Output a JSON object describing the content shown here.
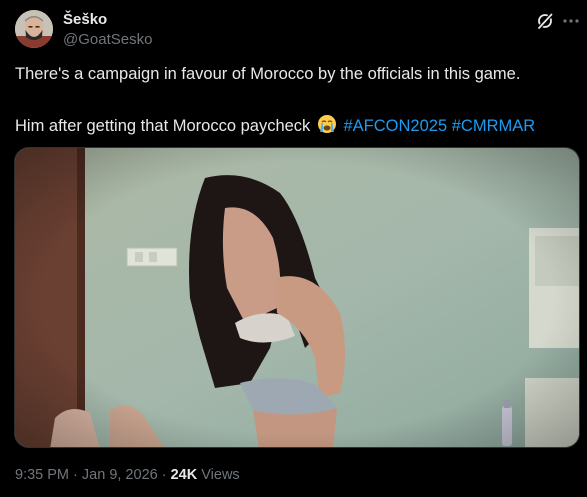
{
  "author": {
    "display_name": "Šeško",
    "handle": "@GoatSesko"
  },
  "tweet": {
    "line1": "There's a campaign in favour of Morocco by the officials in this game.",
    "line2": "Him after getting that Morocco paycheck",
    "emoji": "loudly-crying-face",
    "hashtags": [
      "#AFCON2025",
      "#CMRMAR"
    ]
  },
  "meta": {
    "time": "9:35 PM",
    "separator": "·",
    "date": "Jan 9, 2026",
    "views_count": "24K",
    "views_label": "Views"
  },
  "icons": {
    "grok": "grok-icon",
    "more": "more-options-icon"
  },
  "colors": {
    "background": "#000000",
    "text": "#e7e9ea",
    "muted": "#71767b",
    "hashtag": "#1d9bf0"
  }
}
